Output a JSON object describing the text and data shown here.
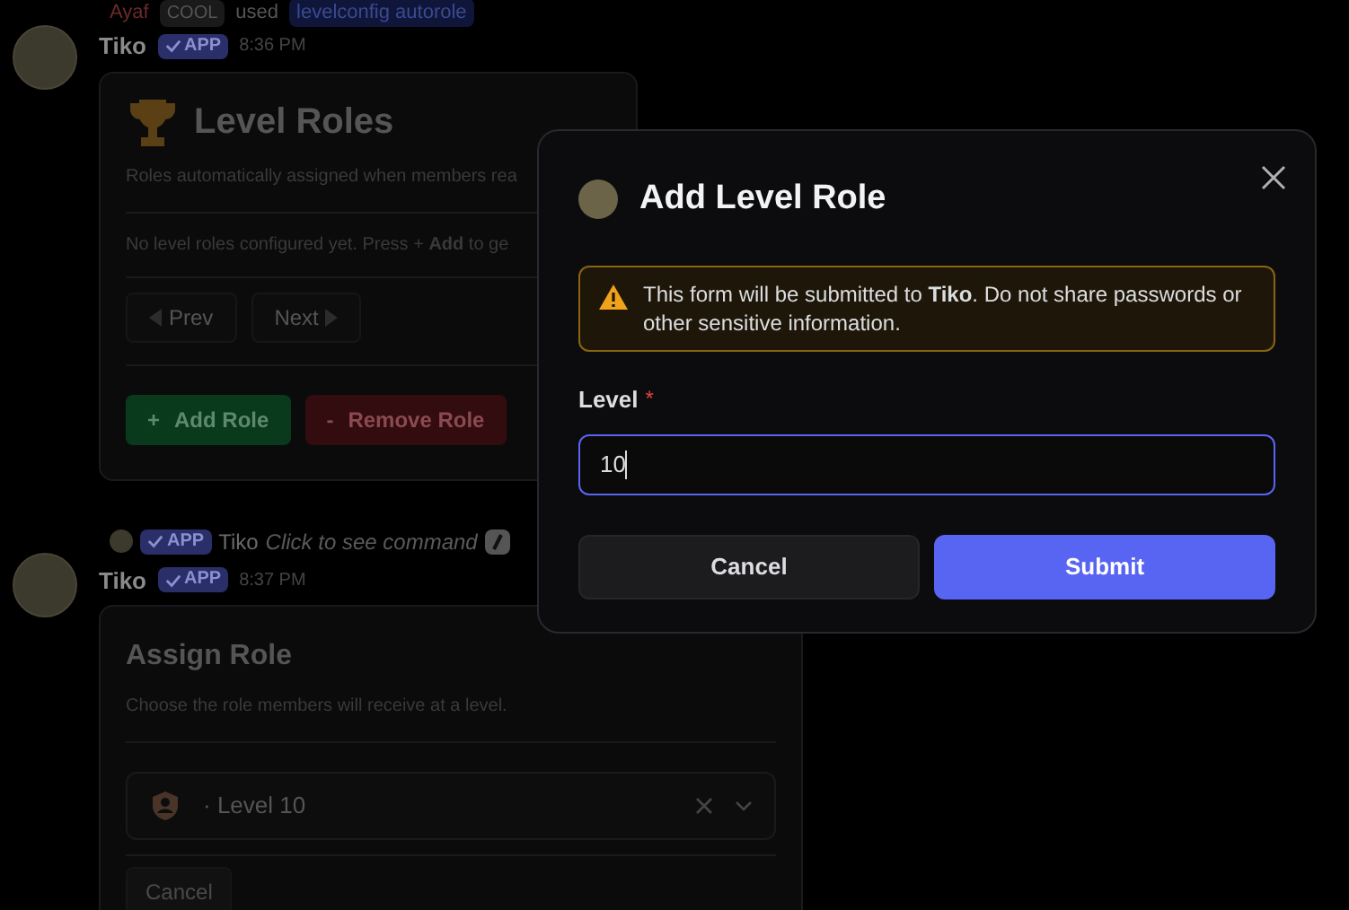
{
  "command_line": {
    "user": "Ayaf",
    "tag": "COOL",
    "verb": "used",
    "command": "levelconfig autorole"
  },
  "message_1": {
    "author": "Tiko",
    "badge": "APP",
    "time": "8:36 PM",
    "title": "Level Roles",
    "description": "Roles automatically assigned when members rea",
    "empty_text": "No level roles configured yet. Press + **Add** to ge",
    "pager": [
      {
        "label": "Prev",
        "disabled": true
      },
      {
        "label": "Next",
        "disabled": true
      }
    ],
    "actions": [
      {
        "icon": "+",
        "label": "Add Role",
        "kind": "add"
      },
      {
        "icon": "-",
        "label": "Remove Role",
        "kind": "remove"
      }
    ]
  },
  "reply_line": {
    "badge": "APP",
    "author": "Tiko",
    "text": "Click to see command"
  },
  "message_2": {
    "author": "Tiko",
    "badge": "APP",
    "time": "8:37 PM",
    "title": "Assign Role",
    "description": "Choose the role members will receive at a level.",
    "select_value": "· Level 10",
    "cancel": "Cancel"
  },
  "modal": {
    "title": "Add Level Role",
    "warning": "This form will be submitted to **Tiko**. Do not share passwords or other sensitive information.",
    "field_label": "Level",
    "required_mark": "*",
    "field_value": "10",
    "focused": true,
    "buttons": [
      {
        "label": "Cancel",
        "kind": "secondary"
      },
      {
        "label": "Submit",
        "kind": "primary"
      }
    ]
  }
}
